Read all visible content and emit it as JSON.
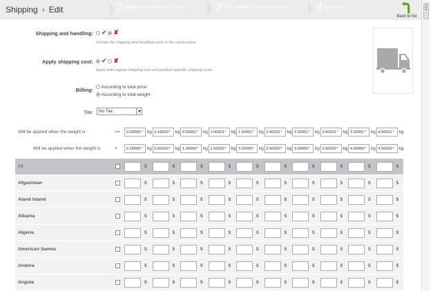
{
  "header": {
    "breadcrumb_parent": "Shipping",
    "breadcrumb_sep": "›",
    "breadcrumb_current": "Edit",
    "steps": [
      {
        "number": "2",
        "label": "Shipping locations and costs"
      },
      {
        "number": "3",
        "label": "Size, weight, and group access"
      },
      {
        "number": "4",
        "label": "Summary"
      }
    ],
    "back_label": "Back to list"
  },
  "settings": {
    "shipping_handling_label": "Shipping and handling:",
    "shipping_handling_hint": "Include the shipping and handling costs in the carrier price.",
    "apply_cost_label": "Apply shipping cost:",
    "apply_cost_hint": "Apply both regular shipping cost and product-specific shipping costs.",
    "billing_label": "Billing:",
    "billing_options": [
      "According to total price",
      "According to total weight"
    ],
    "tax_label": "Tax:",
    "tax_value": "No Tax"
  },
  "ranges": {
    "from_label": "Will be applied when the weight is",
    "to_label": "Will be applied when the weight is",
    "from_op": ">=",
    "to_op": "<",
    "unit": "kg",
    "from_values": [
      "0.00000",
      "0.18600",
      "0.50001",
      "1.00001",
      "1.50001",
      "2.00001",
      "2.50001",
      "3.00001",
      "3.50001",
      "4.00001"
    ],
    "to_values": [
      "0.18500",
      "0.50000",
      "1.00000",
      "1.50000",
      "2.00000",
      "2.50000",
      "3.00000",
      "3.50000",
      "4.00000",
      "4.50000"
    ],
    "required_mark": "*"
  },
  "zones": {
    "currency": "$",
    "rows": [
      "All",
      "Afganistan",
      "Aland Island",
      "Albania",
      "Algeria",
      "American Samos",
      "Andora",
      "Angola"
    ]
  }
}
